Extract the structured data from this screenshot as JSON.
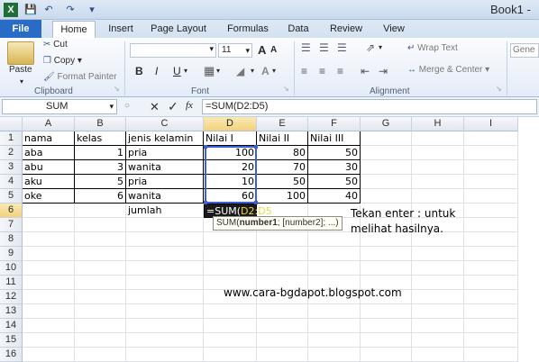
{
  "window": {
    "title": "Book1",
    "title_suffix": "-"
  },
  "quick_access": {
    "save": "save-icon",
    "undo": "undo-icon",
    "redo": "redo-icon",
    "customize": "▾"
  },
  "tabs": [
    "File",
    "Home",
    "Insert",
    "Page Layout",
    "Formulas",
    "Data",
    "Review",
    "View"
  ],
  "ribbon": {
    "clipboard": {
      "paste": "Paste",
      "cut": "Cut",
      "copy": "Copy",
      "format_painter": "Format Painter",
      "group": "Clipboard"
    },
    "font": {
      "font_size": "11",
      "bold": "B",
      "italic": "I",
      "underline": "U",
      "grow": "A",
      "shrink": "A",
      "group": "Font"
    },
    "alignment": {
      "wrap_text": "Wrap Text",
      "merge_center": "Merge & Center",
      "group": "Alignment"
    },
    "number": {
      "format": "Gene"
    }
  },
  "formula_bar": {
    "name_box": "SUM",
    "cancel": "✕",
    "enter": "✓",
    "fx": "fx",
    "formula": "=SUM(D2:D5)"
  },
  "columns": [
    "A",
    "B",
    "C",
    "D",
    "E",
    "F",
    "G",
    "H",
    "I"
  ],
  "rows": [
    "1",
    "2",
    "3",
    "4",
    "5",
    "6",
    "7",
    "8",
    "9",
    "10",
    "11",
    "12",
    "13",
    "14",
    "15",
    "16"
  ],
  "cells": {
    "header": [
      "nama",
      "kelas",
      "jenis kelamin",
      "Nilai I",
      "Nilai II",
      "Nilai III"
    ],
    "data": [
      [
        "aba",
        "1",
        "pria",
        "100",
        "80",
        "50"
      ],
      [
        "abu",
        "3",
        "wanita",
        "20",
        "70",
        "30"
      ],
      [
        "aku",
        "5",
        "pria",
        "10",
        "50",
        "50"
      ],
      [
        "oke",
        "6",
        "wanita",
        "60",
        "100",
        "40"
      ]
    ],
    "total_label": "jumlah",
    "editing_prefix": "=SUM(",
    "editing_ref": "D2:D5",
    "editing_suffix": ")"
  },
  "tooltip": {
    "prefix": "SUM(",
    "arg1": "number1",
    "rest": "; [number2]; ...)"
  },
  "notes": {
    "line1": "Tekan enter : untuk",
    "line2": "melihat hasilnya.",
    "website": "www.cara-bgdapot.blogspot.com"
  },
  "colors": {
    "accent": "#2a6bc6",
    "range_border": "#3b5fd6",
    "ref_text": "#f2d44a"
  }
}
